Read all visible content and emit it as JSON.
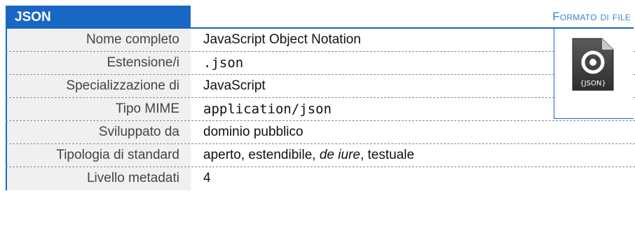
{
  "header": {
    "title": "JSON",
    "category": "Formato di file"
  },
  "rows": [
    {
      "label": "Nome completo",
      "value": "JavaScript Object Notation"
    },
    {
      "label": "Estensione/i",
      "value": ".json"
    },
    {
      "label": "Specializzazione di",
      "value": "JavaScript"
    },
    {
      "label_main": "Tipo ",
      "label_sc": "MIME",
      "value": "application/json"
    },
    {
      "label": "Sviluppato da",
      "value": "dominio pubblico"
    },
    {
      "label": "Tipologia di standard",
      "value_a": "aperto, estendibile, ",
      "value_b": "de iure",
      "value_c": ", testuale"
    },
    {
      "label": "Livello metadati",
      "value": "4"
    }
  ],
  "icon": {
    "name": "json-file-icon",
    "badge": "{JSON}",
    "colors": {
      "body": "#3f3f3f",
      "logo": "#ffffff"
    }
  },
  "colors": {
    "accent": "#1967c4",
    "label_bg": "#f0f0f0"
  }
}
